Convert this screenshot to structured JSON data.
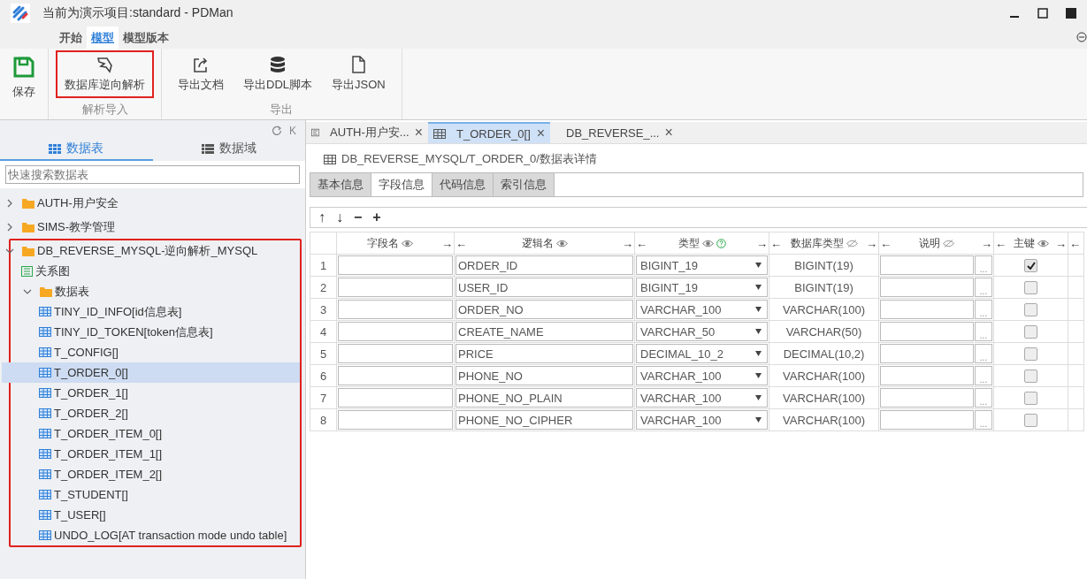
{
  "window": {
    "title": "当前为演示项目:standard - PDMan"
  },
  "ribbon_tabs": [
    {
      "label": "开始",
      "selected": false
    },
    {
      "label": "模型",
      "selected": true
    },
    {
      "label": "模型版本",
      "selected": false
    }
  ],
  "save": {
    "label": "保存"
  },
  "ribbon_groups": [
    {
      "label": "解析导入",
      "buttons": [
        {
          "label": "数据库逆向解析",
          "kind": "reverse",
          "highlighted": true
        }
      ]
    },
    {
      "label": "导出",
      "buttons": [
        {
          "label": "导出文档",
          "kind": "export",
          "highlighted": false
        },
        {
          "label": "导出DDL脚本",
          "kind": "database",
          "highlighted": false
        },
        {
          "label": "导出JSON",
          "kind": "file",
          "highlighted": false
        }
      ]
    }
  ],
  "sidebar": {
    "collapse": "K",
    "tabs": [
      {
        "label": "数据表",
        "kind": "grid",
        "selected": true
      },
      {
        "label": "数据域",
        "kind": "list",
        "selected": false
      }
    ],
    "search": {
      "placeholder": "快速搜索数据表"
    },
    "tree": [
      {
        "label": "AUTH-用户安全",
        "kind": "folder",
        "expanded": false,
        "highlighted": false,
        "selected": false
      },
      {
        "label": "SIMS-教学管理",
        "kind": "folder",
        "expanded": false,
        "highlighted": false,
        "selected": false
      },
      {
        "label": "DB_REVERSE_MYSQL-逆向解析_MYSQL",
        "kind": "folder",
        "expanded": true,
        "highlighted": true,
        "selected": false,
        "children": [
          {
            "label": "关系图",
            "kind": "diagram",
            "selected": false
          },
          {
            "label": "数据表",
            "kind": "folder",
            "expanded": true,
            "selected": false,
            "children": [
              {
                "label": "TINY_ID_INFO[id信息表]",
                "kind": "table",
                "selected": false
              },
              {
                "label": "TINY_ID_TOKEN[token信息表]",
                "kind": "table",
                "selected": false
              },
              {
                "label": "T_CONFIG[]",
                "kind": "table",
                "selected": false
              },
              {
                "label": "T_ORDER_0[]",
                "kind": "table",
                "selected": true
              },
              {
                "label": "T_ORDER_1[]",
                "kind": "table",
                "selected": false
              },
              {
                "label": "T_ORDER_2[]",
                "kind": "table",
                "selected": false
              },
              {
                "label": "T_ORDER_ITEM_0[]",
                "kind": "table",
                "selected": false
              },
              {
                "label": "T_ORDER_ITEM_1[]",
                "kind": "table",
                "selected": false
              },
              {
                "label": "T_ORDER_ITEM_2[]",
                "kind": "table",
                "selected": false
              },
              {
                "label": "T_STUDENT[]",
                "kind": "table",
                "selected": false
              },
              {
                "label": "T_USER[]",
                "kind": "table",
                "selected": false
              },
              {
                "label": "UNDO_LOG[AT transaction mode undo table]",
                "kind": "table",
                "selected": false
              }
            ]
          }
        ]
      }
    ]
  },
  "doc_tabs": [
    {
      "label": "AUTH-用户安...",
      "kind": "diagram",
      "selected": false,
      "close": "×"
    },
    {
      "label": "T_ORDER_0[]",
      "kind": "table",
      "selected": true,
      "close": "×"
    },
    {
      "label": "DB_REVERSE_...",
      "kind": "diagram",
      "selected": false,
      "close": "×"
    }
  ],
  "breadcrumb": "DB_REVERSE_MYSQL/T_ORDER_0/数据表详情",
  "detail_tabs": [
    {
      "label": "基本信息",
      "selected": false
    },
    {
      "label": "字段信息",
      "selected": true
    },
    {
      "label": "代码信息",
      "selected": false
    },
    {
      "label": "索引信息",
      "selected": false
    }
  ],
  "toolbar": [
    "↑",
    "↓",
    "−",
    "+"
  ],
  "table": {
    "columns": [
      {
        "label": "字段名",
        "right": "→",
        "visible": true,
        "help": false
      },
      {
        "left": "←",
        "label": "逻辑名",
        "right": "→",
        "visible": true,
        "help": false
      },
      {
        "left": "←",
        "label": "类型",
        "right": "→",
        "visible": true,
        "help": true
      },
      {
        "left": "←",
        "label": "数据库类型",
        "right": "→",
        "visible": false,
        "help": false
      },
      {
        "left": "←",
        "label": "说明",
        "right": "→",
        "visible": false,
        "help": false
      },
      {
        "left": "←",
        "label": "主键",
        "right": "→",
        "visible": true,
        "help": false
      },
      {
        "left": "←"
      }
    ],
    "rows": [
      {
        "num": "1",
        "logic": "ORDER_ID",
        "type": "BIGINT_19",
        "db_type": "BIGINT(19)",
        "more": "...",
        "primary_key": true
      },
      {
        "num": "2",
        "logic": "USER_ID",
        "type": "BIGINT_19",
        "db_type": "BIGINT(19)",
        "more": "...",
        "primary_key": false
      },
      {
        "num": "3",
        "logic": "ORDER_NO",
        "type": "VARCHAR_100",
        "db_type": "VARCHAR(100)",
        "more": "...",
        "primary_key": false
      },
      {
        "num": "4",
        "logic": "CREATE_NAME",
        "type": "VARCHAR_50",
        "db_type": "VARCHAR(50)",
        "more": "...",
        "primary_key": false
      },
      {
        "num": "5",
        "logic": "PRICE",
        "type": "DECIMAL_10_2",
        "db_type": "DECIMAL(10,2)",
        "more": "...",
        "primary_key": false
      },
      {
        "num": "6",
        "logic": "PHONE_NO",
        "type": "VARCHAR_100",
        "db_type": "VARCHAR(100)",
        "more": "...",
        "primary_key": false
      },
      {
        "num": "7",
        "logic": "PHONE_NO_PLAIN",
        "type": "VARCHAR_100",
        "db_type": "VARCHAR(100)",
        "more": "...",
        "primary_key": false
      },
      {
        "num": "8",
        "logic": "PHONE_NO_CIPHER",
        "type": "VARCHAR_100",
        "db_type": "VARCHAR(100)",
        "more": "...",
        "primary_key": false
      }
    ]
  }
}
